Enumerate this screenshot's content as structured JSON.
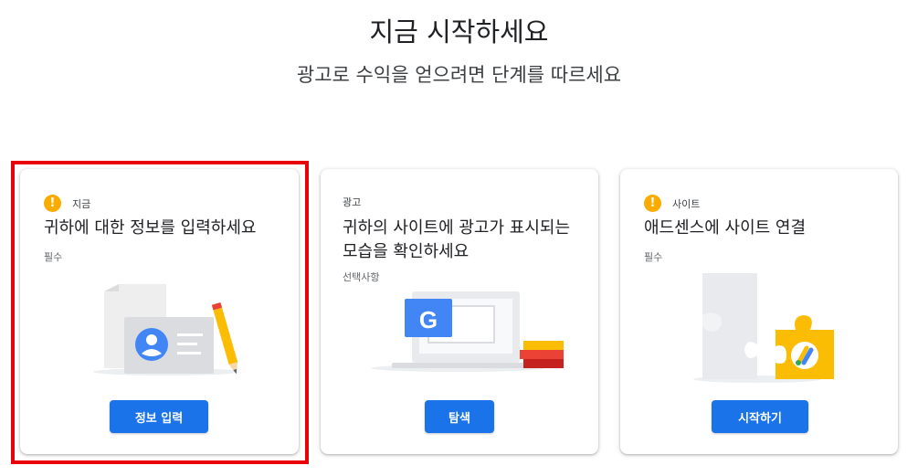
{
  "header": {
    "title": "지금 시작하세요",
    "subtitle": "광고로 수익을 얻으려면 단계를 따르세요"
  },
  "cards": [
    {
      "status": "지금",
      "title": "귀하에 대한 정보를 입력하세요",
      "note": "필수",
      "button": "정보 입력",
      "icon": "warning-icon"
    },
    {
      "status": "광고",
      "title": "귀하의 사이트에 광고가 표시되는 모습을 확인하세요",
      "note": "선택사항",
      "button": "탐색",
      "illustration_letter": "G"
    },
    {
      "status": "사이트",
      "title": "애드센스에 사이트 연결",
      "note": "필수",
      "button": "시작하기",
      "icon": "warning-icon"
    }
  ],
  "colors": {
    "primary_button": "#1a73e8",
    "warning": "#f9ab00",
    "highlight_border": "#e8000b"
  }
}
